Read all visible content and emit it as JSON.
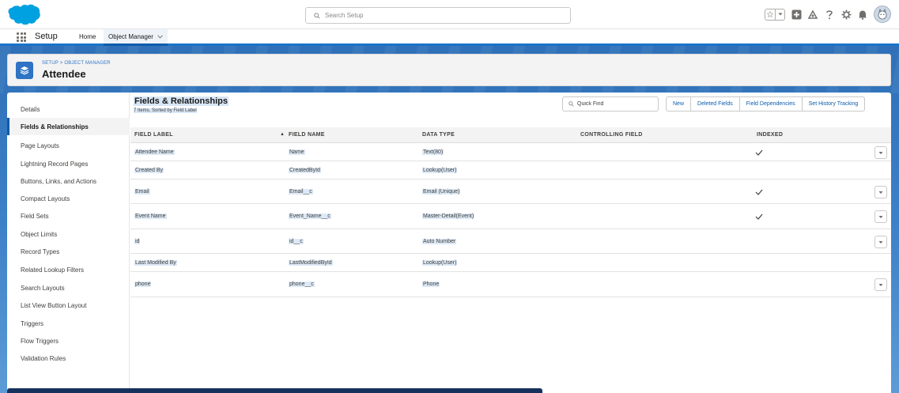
{
  "header": {
    "search_placeholder": "Search Setup"
  },
  "nav": {
    "app_name": "Setup",
    "home": "Home",
    "object_manager": "Object Manager"
  },
  "object": {
    "breadcrumb": "SETUP > OBJECT MANAGER",
    "title": "Attendee"
  },
  "sidebar": {
    "items": [
      {
        "label": "Details",
        "active": false
      },
      {
        "label": "Fields & Relationships",
        "active": true
      },
      {
        "label": "Page Layouts",
        "active": false
      },
      {
        "label": "Lightning Record Pages",
        "active": false
      },
      {
        "label": "Buttons, Links, and Actions",
        "active": false
      },
      {
        "label": "Compact Layouts",
        "active": false
      },
      {
        "label": "Field Sets",
        "active": false
      },
      {
        "label": "Object Limits",
        "active": false
      },
      {
        "label": "Record Types",
        "active": false
      },
      {
        "label": "Related Lookup Filters",
        "active": false
      },
      {
        "label": "Search Layouts",
        "active": false
      },
      {
        "label": "List View Button Layout",
        "active": false
      },
      {
        "label": "Triggers",
        "active": false
      },
      {
        "label": "Flow Triggers",
        "active": false
      },
      {
        "label": "Validation Rules",
        "active": false
      }
    ]
  },
  "section": {
    "title": "Fields & Relationships",
    "subtitle": "7 Items, Sorted by Field Label",
    "quick_find_placeholder": "Quick Find",
    "buttons": [
      "New",
      "Deleted Fields",
      "Field Dependencies",
      "Set History Tracking"
    ]
  },
  "table": {
    "columns": [
      "FIELD LABEL",
      "FIELD NAME",
      "DATA TYPE",
      "CONTROLLING FIELD",
      "INDEXED"
    ],
    "rows": [
      {
        "label": "Attendee Name",
        "name": "Name",
        "type": "Text(80)",
        "controlling": "",
        "indexed": true,
        "menu": true
      },
      {
        "label": "Created By",
        "name": "CreatedById",
        "type": "Lookup(User)",
        "controlling": "",
        "indexed": false,
        "menu": false
      },
      {
        "label": "Email",
        "name": "Email__c",
        "type": "Email (Unique)",
        "controlling": "",
        "indexed": true,
        "menu": true
      },
      {
        "label": "Event Name",
        "name": "Event_Name__c",
        "type": "Master-Detail(Event)",
        "controlling": "",
        "indexed": true,
        "menu": true
      },
      {
        "label": "id",
        "name": "id__c",
        "type": "Auto Number",
        "controlling": "",
        "indexed": false,
        "menu": true
      },
      {
        "label": "Last Modified By",
        "name": "LastModifiedById",
        "type": "Lookup(User)",
        "controlling": "",
        "indexed": false,
        "menu": false
      },
      {
        "label": "phone",
        "name": "phone__c",
        "type": "Phone",
        "controlling": "",
        "indexed": false,
        "menu": true
      }
    ]
  },
  "colors": {
    "brand_blue": "#0b5cab",
    "banner_blue": "#2f70b8",
    "highlight": "#dde9f6"
  },
  "icons": [
    "salesforce-cloud-logo",
    "search-icon",
    "star-icon",
    "dropdown-icon",
    "add-icon",
    "trailhead-icon",
    "help-icon",
    "gear-icon",
    "bell-icon",
    "avatar",
    "app-launcher-icon",
    "chevron-down-icon",
    "layers-icon",
    "checkmark-icon",
    "row-menu-icon"
  ]
}
